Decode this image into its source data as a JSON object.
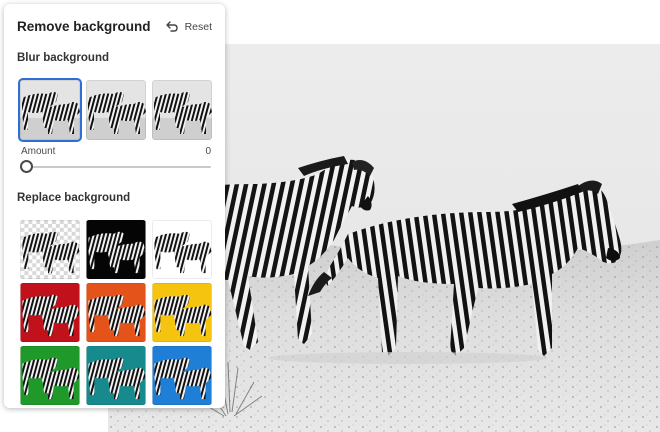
{
  "panel": {
    "title": "Remove background",
    "reset_label": "Reset"
  },
  "blur_section": {
    "title": "Blur background",
    "options": [
      {
        "name": "blur-light",
        "selected": true
      },
      {
        "name": "blur-medium",
        "selected": false
      },
      {
        "name": "blur-strong",
        "selected": false
      }
    ],
    "amount_label": "Amount",
    "amount_value": "0"
  },
  "replace_section": {
    "title": "Replace background",
    "swatches": [
      {
        "name": "transparent",
        "color": "#ffffff"
      },
      {
        "name": "black",
        "color": "#050505"
      },
      {
        "name": "white",
        "color": "#ffffff"
      },
      {
        "name": "red",
        "color": "#c1121c"
      },
      {
        "name": "orange",
        "color": "#e4541a"
      },
      {
        "name": "yellow",
        "color": "#f4c40f"
      },
      {
        "name": "green",
        "color": "#1f9a2a"
      },
      {
        "name": "teal",
        "color": "#178a8e"
      },
      {
        "name": "blue",
        "color": "#1f7ed6"
      }
    ]
  },
  "colors": {
    "accent": "#2f6ed9",
    "panel_bg": "#ffffff"
  },
  "icons": [
    "undo-arrow-icon"
  ]
}
